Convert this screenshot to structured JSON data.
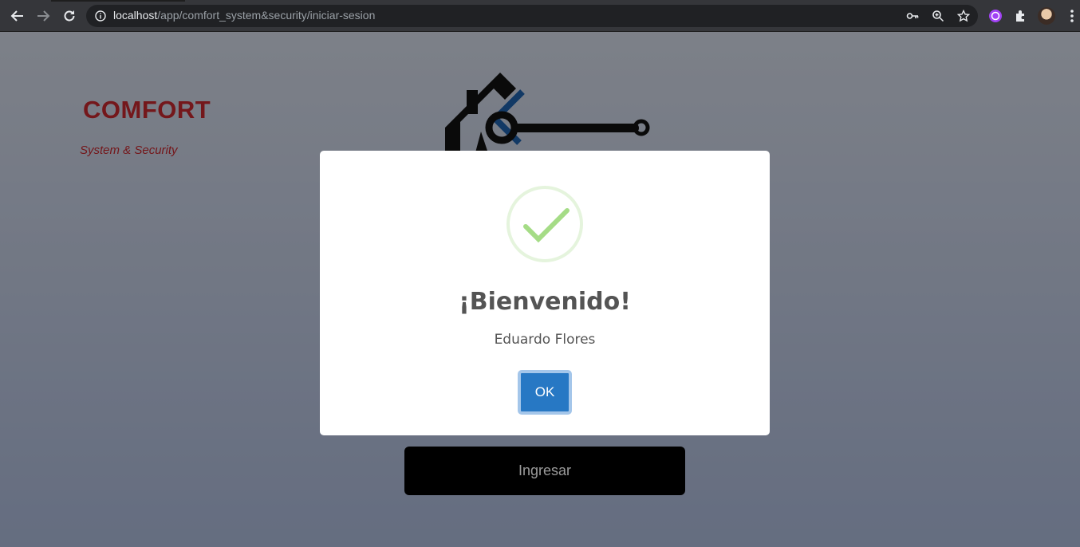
{
  "browser": {
    "url_host": "localhost",
    "url_path": "/app/comfort_system&security/iniciar-sesion"
  },
  "page": {
    "logo_name": "COMFORT",
    "logo_tagline": "System & Security",
    "submit_label": "Ingresar"
  },
  "modal": {
    "title": "¡Bienvenido!",
    "text": "Eduardo Flores",
    "confirm_label": "OK"
  },
  "colors": {
    "confirm": "#2778c4",
    "success": "#a5dc86",
    "brand_red": "#c1272d",
    "brand_blue": "#1f5fa8"
  }
}
